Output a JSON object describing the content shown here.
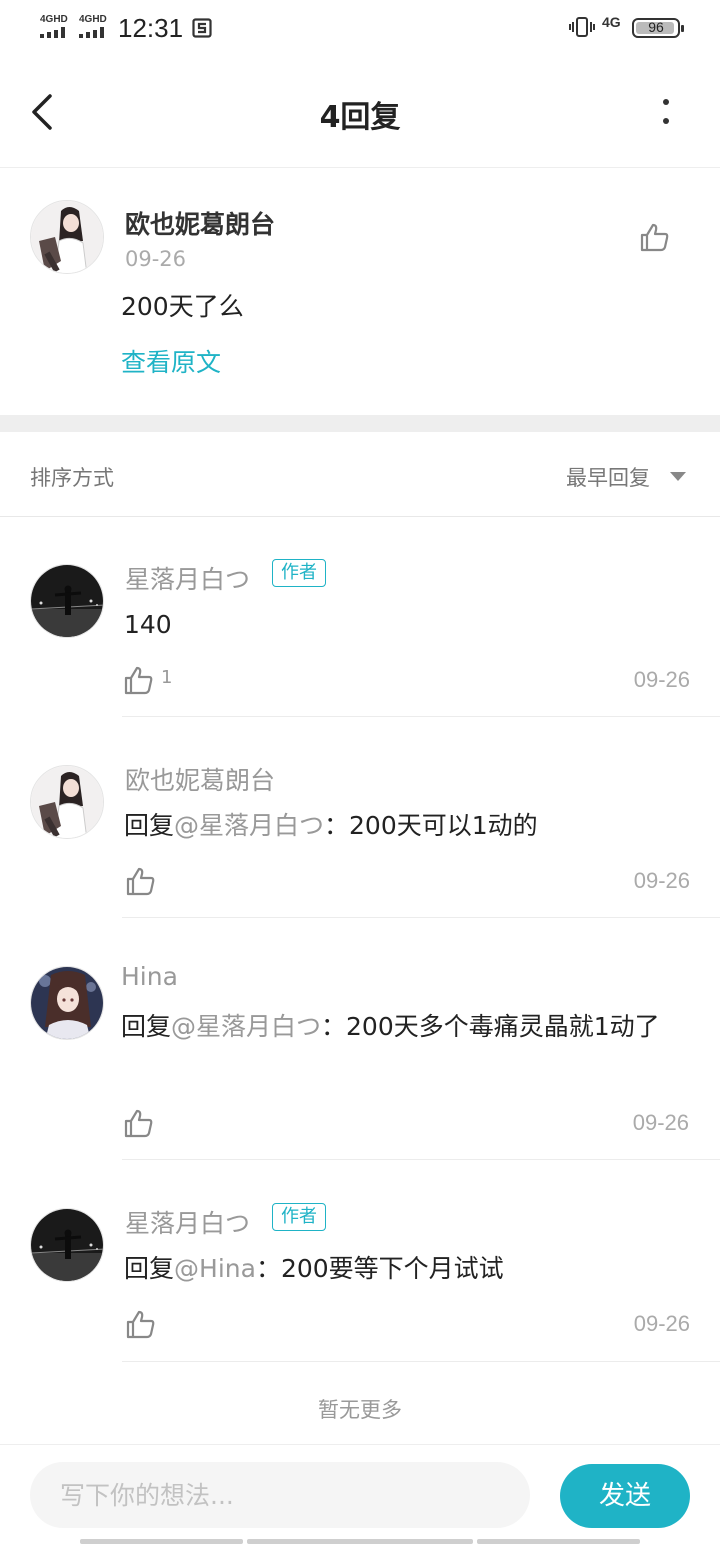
{
  "status_bar": {
    "sim1": "4GHD",
    "sim2": "4GHD",
    "time": "12:31",
    "network": "4G",
    "battery": "96",
    "battery_level_percent": 96
  },
  "header": {
    "title": "4回复"
  },
  "original_comment": {
    "author": "欧也妮葛朗台",
    "date": "09-26",
    "text": "200天了么",
    "view_original": "查看原文"
  },
  "sort": {
    "label": "排序方式",
    "value": "最早回复"
  },
  "replies": [
    {
      "author": "星落月白つ",
      "badge": "作者",
      "text": "140",
      "likes": "1",
      "date": "09-26"
    },
    {
      "author": "欧也妮葛朗台",
      "prefix": "回复",
      "mention": "@星落月白つ",
      "text": "：200天可以1动的",
      "date": "09-26"
    },
    {
      "author": "Hina",
      "prefix": "回复",
      "mention": "@星落月白つ",
      "text": "：200天多个毒痛灵晶就1动了",
      "date": "09-26"
    },
    {
      "author": "星落月白つ",
      "badge": "作者",
      "prefix": "回复",
      "mention": "@Hina",
      "text": "：200要等下个月试试",
      "date": "09-26"
    }
  ],
  "no_more": "暂无更多",
  "input": {
    "placeholder": "写下你的想法...",
    "send_label": "发送"
  },
  "colors": {
    "accent": "#1fb3c6",
    "muted": "#999999"
  }
}
